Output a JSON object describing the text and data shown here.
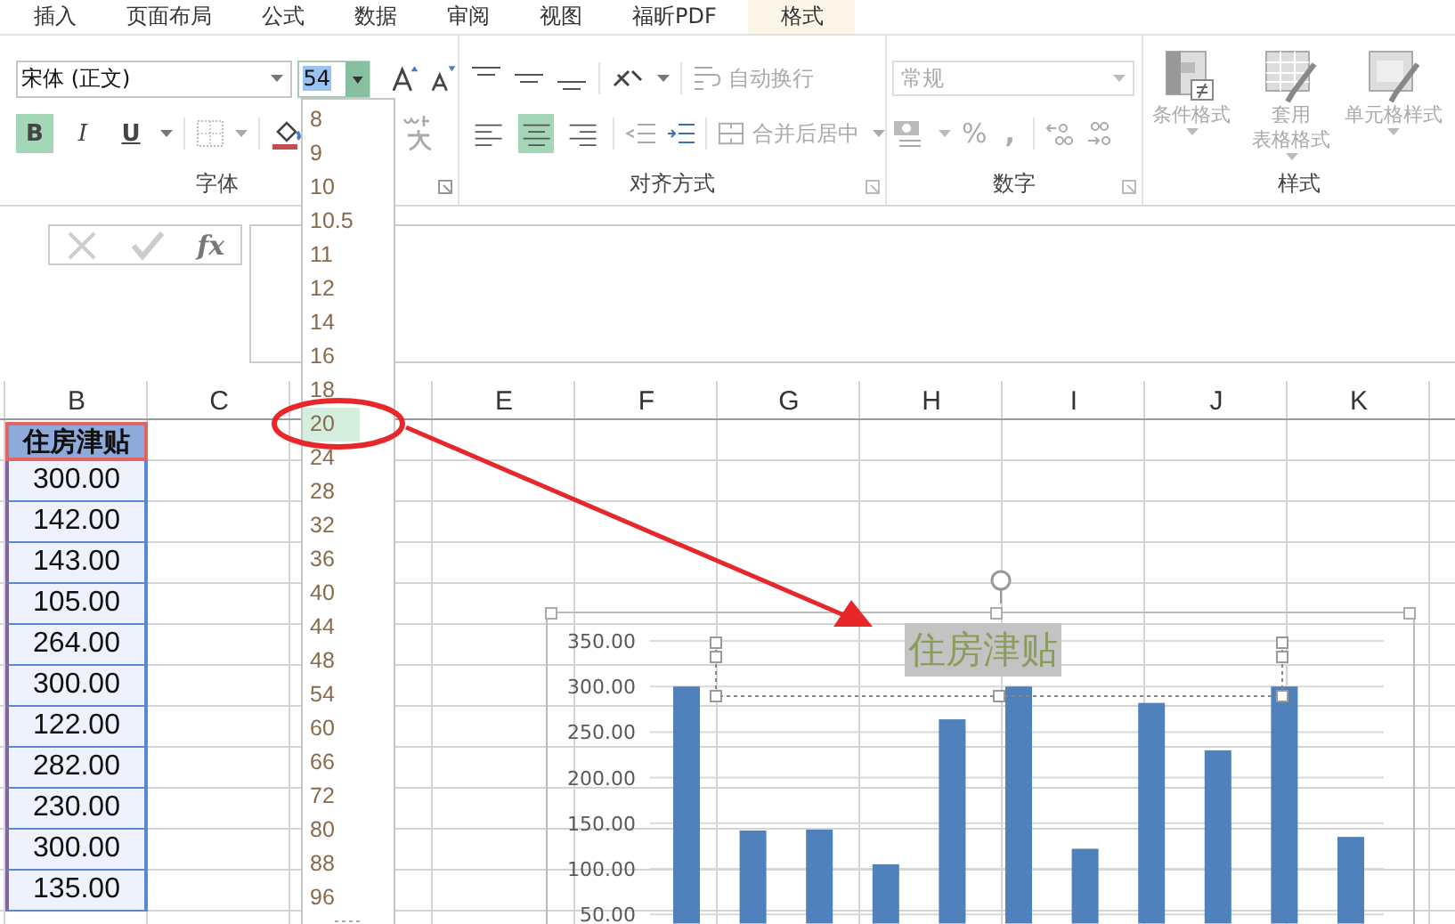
{
  "ribbon_tabs": [
    {
      "label": "插入",
      "selected": false
    },
    {
      "label": "页面布局",
      "selected": false
    },
    {
      "label": "公式",
      "selected": false
    },
    {
      "label": "数据",
      "selected": false
    },
    {
      "label": "审阅",
      "selected": false
    },
    {
      "label": "视图",
      "selected": false
    },
    {
      "label": "福昕PDF",
      "selected": false
    },
    {
      "label": "格式",
      "selected": true
    }
  ],
  "font_group": {
    "label": "字体",
    "font_name": "宋体 (正文)",
    "font_size": "54",
    "format_buttons": [
      {
        "kind": "bold",
        "label": "B",
        "on": true
      },
      {
        "kind": "italic",
        "label": "I",
        "on": false
      },
      {
        "kind": "underline",
        "label": "U",
        "on": false
      }
    ]
  },
  "alignment_group": {
    "label": "对齐方式",
    "wrap_text": "自动换行",
    "merge_center": "合并后居中",
    "horizontal_align": [
      {
        "kind": "left",
        "selected": false
      },
      {
        "kind": "center",
        "selected": true
      },
      {
        "kind": "right",
        "selected": false
      }
    ]
  },
  "number_group": {
    "label": "数字",
    "format": "常规",
    "percent": "%",
    "comma": ","
  },
  "styles_group": {
    "label": "样式",
    "buttons": [
      {
        "lines": [
          "条件格式"
        ],
        "kind": "conditional"
      },
      {
        "lines": [
          "套用",
          "表格格式"
        ],
        "kind": "table"
      },
      {
        "lines": [
          "单元格样式"
        ],
        "kind": "cell"
      }
    ]
  },
  "formula_bar": {
    "function_label": "fx"
  },
  "columns_left": [
    "B",
    "C"
  ],
  "columns_right": [
    "E",
    "F",
    "G",
    "H",
    "I",
    "J",
    "K"
  ],
  "column_b": {
    "header": "住房津贴",
    "values": [
      "300.00",
      "142.00",
      "143.00",
      "105.00",
      "264.00",
      "300.00",
      "122.00",
      "282.00",
      "230.00",
      "300.00",
      "135.00"
    ]
  },
  "font_size_dropdown": {
    "options": [
      {
        "label": "8",
        "selected": false
      },
      {
        "label": "9",
        "selected": false
      },
      {
        "label": "10",
        "selected": false
      },
      {
        "label": "10.5",
        "selected": false
      },
      {
        "label": "11",
        "selected": false
      },
      {
        "label": "12",
        "selected": false
      },
      {
        "label": "14",
        "selected": false
      },
      {
        "label": "16",
        "selected": false
      },
      {
        "label": "18",
        "selected": false
      },
      {
        "label": "20",
        "selected": true
      },
      {
        "label": "24",
        "selected": false
      },
      {
        "label": "28",
        "selected": false
      },
      {
        "label": "32",
        "selected": false
      },
      {
        "label": "36",
        "selected": false
      },
      {
        "label": "40",
        "selected": false
      },
      {
        "label": "44",
        "selected": false
      },
      {
        "label": "48",
        "selected": false
      },
      {
        "label": "54",
        "selected": false
      },
      {
        "label": "60",
        "selected": false
      },
      {
        "label": "66",
        "selected": false
      },
      {
        "label": "72",
        "selected": false
      },
      {
        "label": "80",
        "selected": false
      },
      {
        "label": "88",
        "selected": false
      },
      {
        "label": "96",
        "selected": false
      }
    ]
  },
  "chart": {
    "title": "住房津贴",
    "chart_data": {
      "type": "bar",
      "grid": true,
      "ylim": [
        40,
        350
      ],
      "series": [
        {
          "color": "#4f81bd",
          "values": [
            300,
            142,
            143,
            105,
            264,
            300,
            122,
            282,
            230,
            300,
            135
          ]
        }
      ],
      "yticks": [
        {
          "value": 350,
          "label": "350.00"
        },
        {
          "value": 300,
          "label": "300.00"
        },
        {
          "value": 250,
          "label": "250.00"
        },
        {
          "value": 200,
          "label": "200.00"
        },
        {
          "value": 150,
          "label": "150.00"
        },
        {
          "value": 100,
          "label": "100.00"
        },
        {
          "value": 50,
          "label": "50.00"
        }
      ]
    }
  }
}
